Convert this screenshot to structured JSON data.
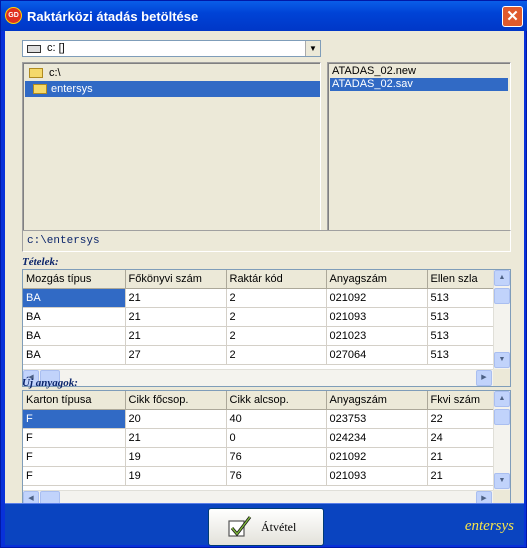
{
  "window": {
    "title": "Raktárközi átadás betöltése",
    "icon_text": "GD",
    "close_glyph": "✕"
  },
  "drive": {
    "value": "c: []"
  },
  "folders": [
    {
      "label": "c:\\",
      "selected": false
    },
    {
      "label": "entersys",
      "selected": true
    }
  ],
  "files": [
    {
      "label": "ATADAS_02.new",
      "selected": false
    },
    {
      "label": "ATADAS_02.sav",
      "selected": true
    }
  ],
  "path": "c:\\entersys",
  "tetelek": {
    "label": "Tételek:",
    "columns": [
      "Mozgás típus",
      "Főkönyvi szám",
      "Raktár kód",
      "Anyagszám",
      "Ellen szla"
    ],
    "rows": [
      [
        "BA",
        "21",
        "2",
        "021092",
        "513"
      ],
      [
        "BA",
        "21",
        "2",
        "021093",
        "513"
      ],
      [
        "BA",
        "21",
        "2",
        "021023",
        "513"
      ],
      [
        "BA",
        "27",
        "2",
        "027064",
        "513"
      ]
    ]
  },
  "uj_anyagok": {
    "label": "Új anyagok:",
    "columns": [
      "Karton típusa",
      "Cikk főcsop.",
      "Cikk alcsop.",
      "Anyagszám",
      "Fkvi szám"
    ],
    "rows": [
      [
        "F",
        "20",
        "40",
        "023753",
        "22"
      ],
      [
        "F",
        "21",
        "0",
        "024234",
        "24"
      ],
      [
        "F",
        "19",
        "76",
        "021092",
        "21"
      ],
      [
        "F",
        "19",
        "76",
        "021093",
        "21"
      ]
    ]
  },
  "footer": {
    "accept_label": "Átvétel",
    "brand": "entersys"
  },
  "colors": {
    "titlebar": "#0043d6",
    "selection": "#316ac5",
    "footer": "#0a44c0",
    "brand": "#f7e44a"
  }
}
